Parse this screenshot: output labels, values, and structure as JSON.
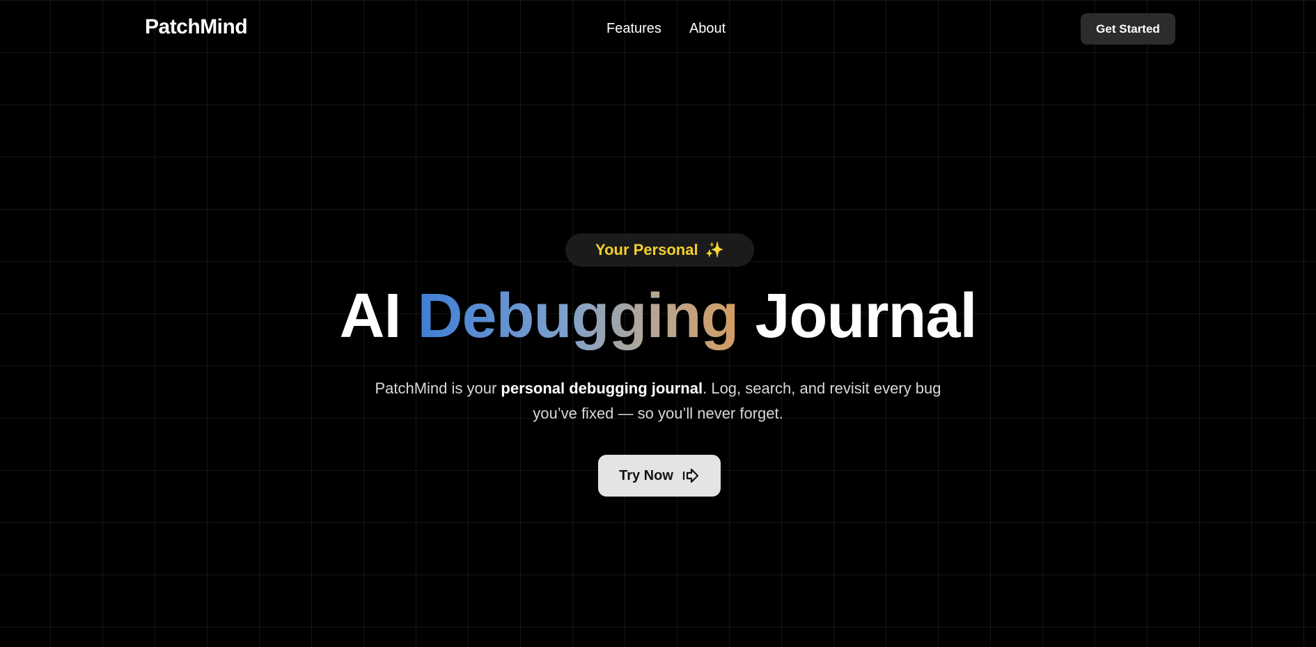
{
  "nav": {
    "logo": "PatchMind",
    "links": [
      {
        "label": "Features"
      },
      {
        "label": "About"
      }
    ],
    "cta_label": "Get Started"
  },
  "hero": {
    "badge_text": "Your Personal",
    "badge_icon": "sparkles-icon",
    "badge_glyph": "✨",
    "headline": {
      "part1": "AI",
      "part2": "Debugging",
      "part3": "Journal"
    },
    "subtitle": {
      "prefix": "PatchMind is your ",
      "bold": "personal debugging journal",
      "suffix": ". Log, search, and revisit every bug",
      "line2": "you’ve fixed — so you’ll never forget."
    },
    "button_label": "Try Now",
    "button_icon": "arrow-right-icon"
  },
  "colors": {
    "background": "#000000",
    "badge_text": "#f4cf2e",
    "gradient_start": "#3f7ed6",
    "gradient_end": "#d49c62",
    "nav_button_bg": "#2c2c2c",
    "primary_button_bg": "#e4e4e4"
  }
}
